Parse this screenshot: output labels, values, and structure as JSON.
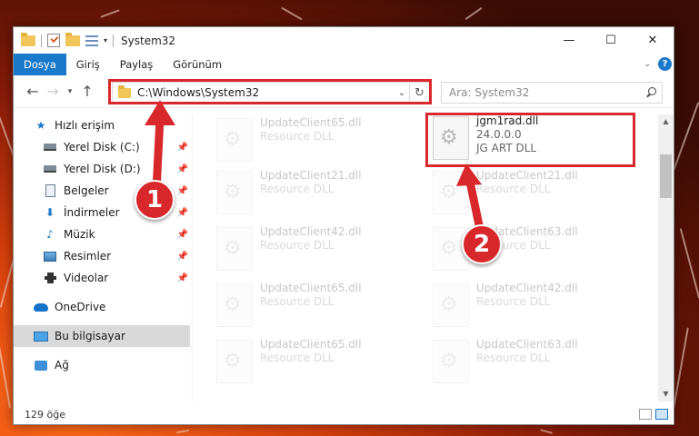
{
  "window": {
    "title": "System32",
    "controls": {
      "minimize": "—",
      "maximize": "☐",
      "close": "✕"
    }
  },
  "ribbon": {
    "tabs": [
      "Dosya",
      "Giriş",
      "Paylaş",
      "Görünüm"
    ],
    "expand_chevron": "⌄",
    "help": "?"
  },
  "navigation": {
    "back": "←",
    "forward": "→",
    "recent": "▾",
    "up": "↑",
    "address_value": "C:\\Windows\\System32",
    "address_dropdown": "⌄",
    "refresh": "↻",
    "search_placeholder": "Ara: System32"
  },
  "sidebar": {
    "quick_access": "Hızlı erişim",
    "items": [
      {
        "label": "Yerel Disk (C:)",
        "icon": "drive-icon",
        "pinned": true
      },
      {
        "label": "Yerel Disk (D:)",
        "icon": "drive-icon",
        "pinned": true
      },
      {
        "label": "Belgeler",
        "icon": "documents-icon",
        "pinned": true
      },
      {
        "label": "İndirmeler",
        "icon": "downloads-icon",
        "pinned": true
      },
      {
        "label": "Müzik",
        "icon": "music-icon",
        "pinned": true
      },
      {
        "label": "Resimler",
        "icon": "pictures-icon",
        "pinned": true
      },
      {
        "label": "Videolar",
        "icon": "videos-icon",
        "pinned": true
      }
    ],
    "onedrive": "OneDrive",
    "this_pc": "Bu bilgisayar",
    "network": "Ağ",
    "pin_glyph": "📌"
  },
  "files": {
    "left_column": [
      {
        "name": "UpdateClient65.dll",
        "type": "Resource DLL"
      },
      {
        "name": "UpdateClient21.dll",
        "type": "Resource DLL"
      },
      {
        "name": "UpdateClient42.dll",
        "type": "Resource DLL"
      },
      {
        "name": "UpdateClient65.dll",
        "type": "Resource DLL"
      },
      {
        "name": "UpdateClient65.dll",
        "type": "Resource DLL"
      }
    ],
    "right_column": [
      {
        "name": "jgm1rad.dll",
        "version": "24.0.0.0",
        "type": "JG ART DLL",
        "highlighted": true
      },
      {
        "name": "UpdateClient21.dll",
        "type": "Resource DLL"
      },
      {
        "name": "UpdateClient63.dll",
        "type": "Resource DLL"
      },
      {
        "name": "UpdateClient42.dll",
        "type": "Resource DLL"
      },
      {
        "name": "UpdateClient63.dll",
        "type": "Resource DLL"
      }
    ]
  },
  "status": {
    "item_count": "129 öğe"
  },
  "annotations": {
    "callout_1": "1",
    "callout_2": "2",
    "color": "#d8282b"
  }
}
